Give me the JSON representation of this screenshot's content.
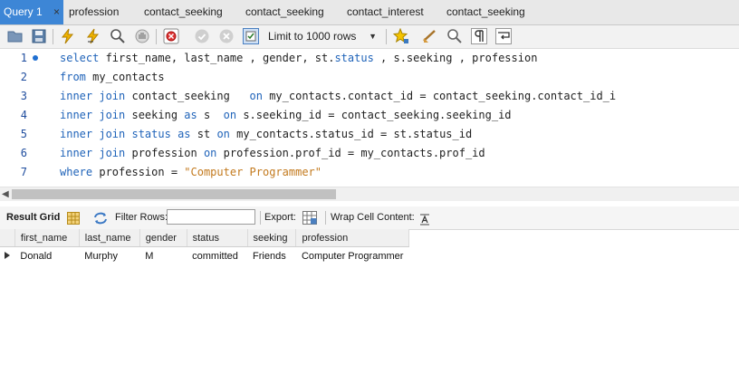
{
  "tabs": [
    {
      "label": "Query 1",
      "active": true,
      "close": "×"
    },
    {
      "label": "profession"
    },
    {
      "label": "contact_seeking"
    },
    {
      "label": "contact_seeking"
    },
    {
      "label": "contact_interest"
    },
    {
      "label": "contact_seeking"
    }
  ],
  "toolbar": {
    "limit_label": "Limit to 1000 rows",
    "icons": [
      "folder-open-icon",
      "save-icon",
      "execute-icon",
      "execute-current-icon",
      "explain-icon",
      "stop-icon",
      "toggle-continue-icon",
      "commit-icon",
      "rollback-icon",
      "autocommit-icon",
      "beautify-icon",
      "snippet-icon",
      "find-icon",
      "invisible-chars-icon",
      "wrap-icon"
    ]
  },
  "editor": {
    "line_numbers": [
      "1",
      "2",
      "3",
      "4",
      "5",
      "6",
      "7"
    ],
    "lines": [
      [
        [
          "kw",
          "select"
        ],
        [
          "p",
          " first_name, last_name , gender, st."
        ],
        [
          "kw",
          "status"
        ],
        [
          "p",
          " , s.seeking , profession"
        ]
      ],
      [
        [
          "kw",
          "from"
        ],
        [
          "p",
          " my_contacts"
        ]
      ],
      [
        [
          "kw",
          "inner join"
        ],
        [
          "p",
          " contact_seeking   "
        ],
        [
          "kw",
          "on"
        ],
        [
          "p",
          " my_contacts.contact_id = contact_seeking.contact_id_i"
        ]
      ],
      [
        [
          "kw",
          "inner join"
        ],
        [
          "p",
          " seeking "
        ],
        [
          "kw",
          "as"
        ],
        [
          "p",
          " s  "
        ],
        [
          "kw",
          "on"
        ],
        [
          "p",
          " s.seeking_id = contact_seeking.seeking_id"
        ]
      ],
      [
        [
          "kw",
          "inner join"
        ],
        [
          "p",
          " "
        ],
        [
          "kw",
          "status"
        ],
        [
          "p",
          " "
        ],
        [
          "kw",
          "as"
        ],
        [
          "p",
          " st "
        ],
        [
          "kw",
          "on"
        ],
        [
          "p",
          " my_contacts.status_id = st.status_id"
        ]
      ],
      [
        [
          "kw",
          "inner join"
        ],
        [
          "p",
          " profession "
        ],
        [
          "kw",
          "on"
        ],
        [
          "p",
          " profession.prof_id = my_contacts.prof_id"
        ]
      ],
      [
        [
          "kw",
          "where"
        ],
        [
          "p",
          " profession = "
        ],
        [
          "str",
          "\"Computer Programmer\""
        ]
      ]
    ]
  },
  "result_toolbar": {
    "result_grid": "Result Grid",
    "filter_rows": "Filter Rows:",
    "filter_value": "",
    "export": "Export:",
    "wrap": "Wrap Cell Content:"
  },
  "grid": {
    "columns": [
      "first_name",
      "last_name",
      "gender",
      "status",
      "seeking",
      "profession"
    ],
    "rows": [
      [
        "Donald",
        "Murphy",
        "M",
        "committed",
        "Friends",
        "Computer Programmer"
      ]
    ]
  },
  "colors": {
    "accent": "#3d86d6",
    "keyword": "#1f63b9",
    "string": "#c37a1e",
    "line_number": "#1f4d9e"
  }
}
